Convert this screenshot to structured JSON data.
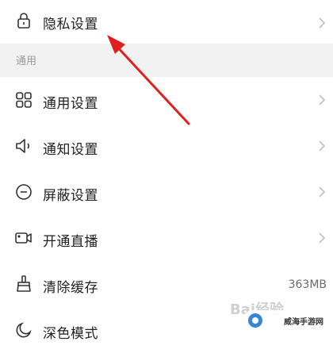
{
  "settings": {
    "privacy": {
      "label": "隐私设置",
      "icon": "lock-icon"
    },
    "section_general": {
      "title": "通用"
    },
    "items": [
      {
        "label": "通用设置",
        "icon": "grid-icon"
      },
      {
        "label": "通知设置",
        "icon": "speaker-icon"
      },
      {
        "label": "屏蔽设置",
        "icon": "minus-circle-icon"
      },
      {
        "label": "开通直播",
        "icon": "video-camera-icon"
      },
      {
        "label": "清除缓存",
        "icon": "broom-icon",
        "value": "363MB"
      },
      {
        "label": "深色模式",
        "icon": "moon-icon"
      }
    ]
  },
  "watermarks": {
    "baidu": "Bai经验",
    "site": "威海手游网"
  },
  "colors": {
    "arrow": "#e02020",
    "section_bg": "#f2f2f2",
    "chevron": "#c0c0c0"
  }
}
